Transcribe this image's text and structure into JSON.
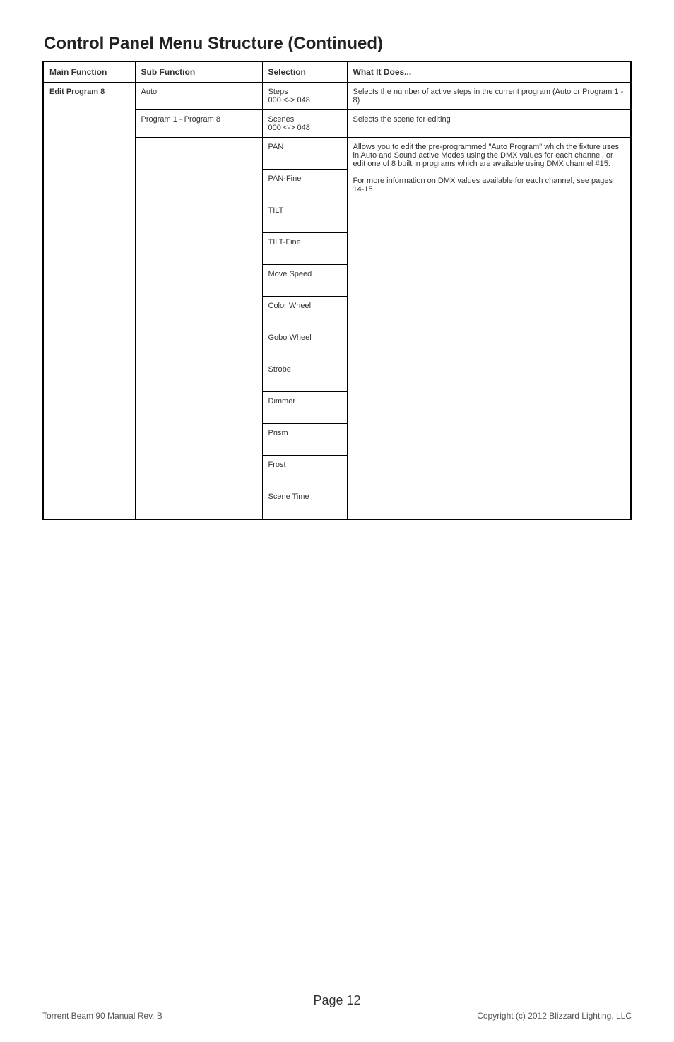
{
  "title": "Control Panel Menu Structure (Continued)",
  "headers": {
    "main_function": "Main Function",
    "sub_function": "Sub Function",
    "selection": "Selection",
    "what_it_does": "What It Does..."
  },
  "rows": {
    "main_function": "Edit Program 8",
    "sub_auto": "Auto",
    "sub_programs": "Program 1 - Program 8",
    "steps_label": "Steps\n000 <-> 048",
    "steps_desc": "Selects the number of active steps in the current program (Auto or Program 1 - 8)",
    "scenes_label": "Scenes\n000 <-> 048",
    "scenes_desc": "Selects the scene for editing",
    "selections": [
      "PAN",
      "PAN-Fine",
      "TILT",
      "TILT-Fine",
      "Move Speed",
      "Color Wheel",
      "Gobo Wheel",
      "Strobe",
      "Dimmer",
      "Prism",
      "Frost",
      "Scene Time"
    ],
    "big_desc": "Allows you to edit the pre-programmed \"Auto Program\" which the fixture uses in Auto and Sound active Modes using the DMX values for each channel, or edit one of 8 built in programs which are available using DMX channel #15.\n\nFor more information on DMX values available for each channel, see pages 14-15."
  },
  "footer": {
    "page_label": "Page 12",
    "left": "Torrent Beam 90 Manual Rev. B",
    "right": "Copyright (c) 2012 Blizzard Lighting, LLC"
  }
}
